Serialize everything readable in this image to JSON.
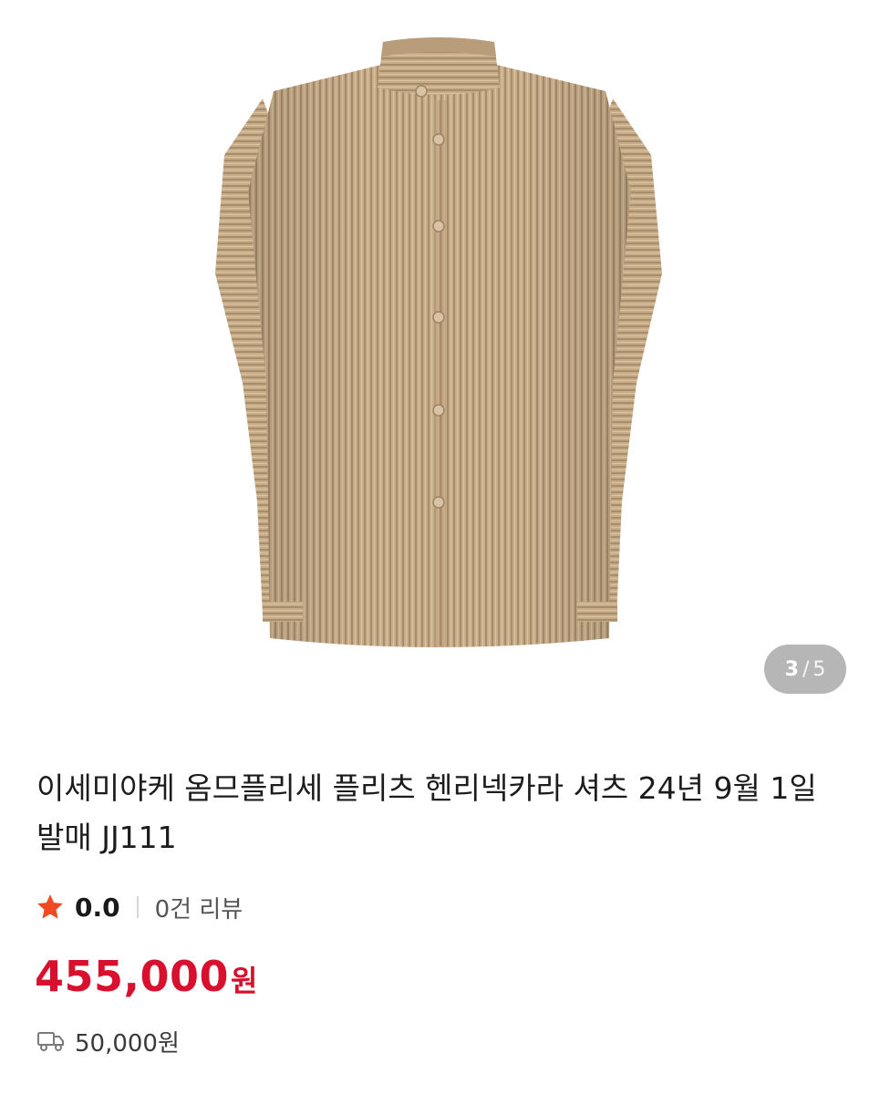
{
  "gallery": {
    "current": "3",
    "separator": "/",
    "total": "5",
    "image_icon": "pleated-shirt-image"
  },
  "product": {
    "title": "이세미야케 옴므플리세 플리츠 헨리넥카라 셔츠 24년 9월 1일 발매 JJ111",
    "rating": "0.0",
    "review_count": "0건 리뷰",
    "price": "455,000",
    "price_unit": "원",
    "shipping_fee": "50,000원"
  },
  "icons": {
    "rating": "star-icon",
    "shipping": "truck-icon"
  },
  "colors": {
    "star": "#f04a25",
    "price": "#d8102d",
    "shirt": "#c8ad8a"
  }
}
